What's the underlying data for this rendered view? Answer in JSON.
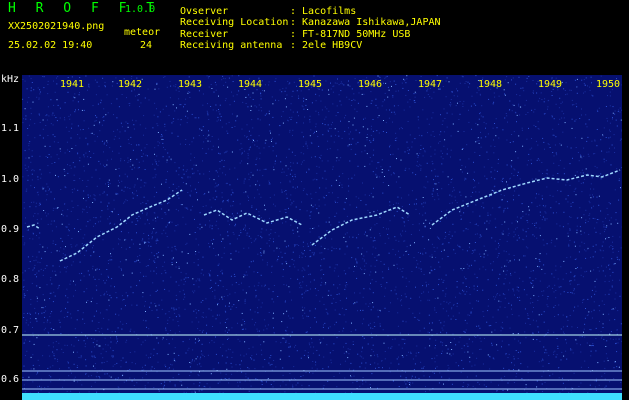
{
  "app": {
    "name": "H R O F F T",
    "version": "1.0.0"
  },
  "file": {
    "name": "XX2502021940.png",
    "datetime": "25.02.02 19:40"
  },
  "meteor": {
    "label": "meteor",
    "count": "24"
  },
  "info": [
    {
      "key": "Ovserver",
      "value": ": Lacofilms"
    },
    {
      "key": "Receiving Location",
      "value": ": Kanazawa Ishikawa,JAPAN"
    },
    {
      "key": "Receiver",
      "value": ": FT-817ND 50MHz USB"
    },
    {
      "key": "Receiving antenna",
      "value": ": 2ele HB9CV"
    }
  ],
  "y_axis": {
    "unit": "kHz",
    "ticks": [
      "1.1",
      "1.0",
      "0.9",
      "0.8",
      "0.7",
      "0.6"
    ]
  },
  "time_axis": [
    "1941",
    "1942",
    "1943",
    "1944",
    "1945",
    "1946",
    "1947",
    "1948",
    "1949",
    "1950"
  ],
  "colors": {
    "background": "#000000",
    "plot_bg": "#061070",
    "signal": "#9fd8ff",
    "accent": "#ffff00",
    "title": "#00ff00"
  }
}
